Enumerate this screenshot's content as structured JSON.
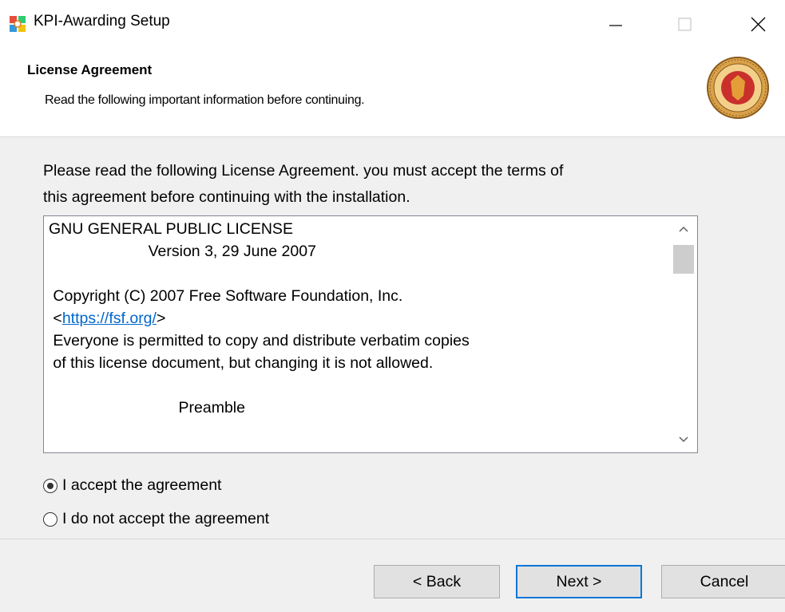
{
  "window": {
    "title": "KPI-Awarding Setup",
    "icon": "installer-app-icon",
    "controls": [
      "minimize-icon",
      "maximize-icon",
      "close-icon"
    ]
  },
  "header": {
    "title": "License Agreement",
    "subtitle": "Read the following important information before continuing.",
    "logo": "kpi-seal-logo"
  },
  "body": {
    "intro_line1": "Please read the following License Agreement. you must accept the terms of",
    "intro_line2": "this agreement before continuing with the installation.",
    "license": {
      "line1": "GNU GENERAL PUBLIC LICENSE",
      "line2": "                       Version 3, 29 June 2007",
      "line3": "",
      "line4": " Copyright (C) 2007 Free Software Foundation, Inc.",
      "link_prefix": " <",
      "link_text": "https://fsf.org/",
      "link_suffix": ">",
      "line6": " Everyone is permitted to copy and distribute verbatim copies",
      "line7": " of this license document, but changing it is not allowed.",
      "line8": "",
      "line9": "                              Preamble"
    }
  },
  "options": {
    "accept_label": "I accept the agreement",
    "decline_label": "I do not accept the agreement",
    "selected": "accept"
  },
  "buttons": {
    "back": "< Back",
    "next": "Next >",
    "cancel": "Cancel"
  },
  "colors": {
    "link": "#0066cc",
    "focus_border": "#0078d7",
    "panel_bg": "#f0f0f0"
  }
}
